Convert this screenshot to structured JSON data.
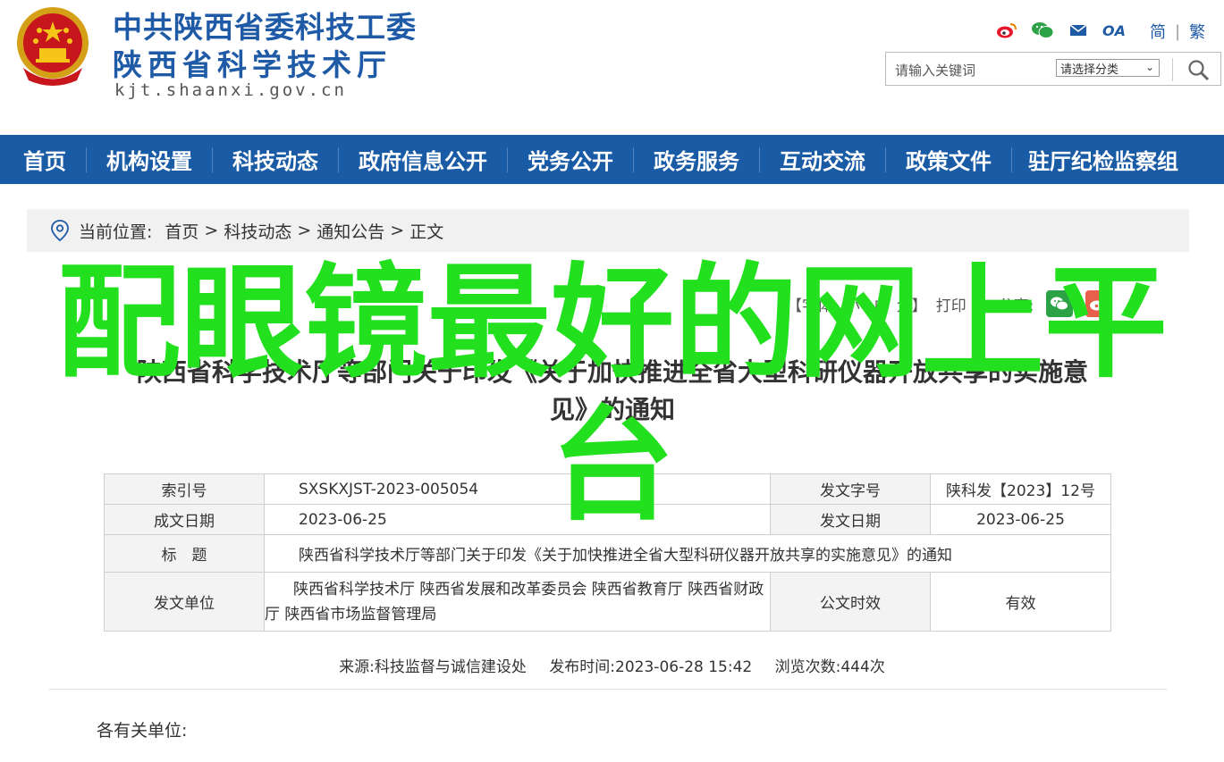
{
  "header": {
    "org_title_1": "中共陕西省委科技工委",
    "org_title_2": "陕西省科学技术厅",
    "domain": "kjt.shaanxi.gov.cn",
    "icons": [
      "weibo-icon",
      "wechat-icon",
      "mail-icon",
      "oa-icon"
    ],
    "oa_label": "OA",
    "lang_simplified": "简",
    "lang_separator": "|",
    "lang_traditional": "繁",
    "search": {
      "placeholder": "请输入关键词",
      "category_select": "请选择分类",
      "button_icon": "search-icon"
    }
  },
  "nav": {
    "items": [
      "首页",
      "机构设置",
      "科技动态",
      "政府信息公开",
      "党务公开",
      "政务服务",
      "互动交流",
      "政策文件",
      "驻厅纪检监察组"
    ]
  },
  "breadcrumb": {
    "prefix": "当前位置:",
    "items": [
      "首页",
      ">",
      "科技动态",
      ">",
      "通知公告",
      ">",
      "正文"
    ]
  },
  "tools": {
    "font_label": "【字体:",
    "font_small": "小",
    "font_medium": "中",
    "font_large": "大",
    "bracket_close": "】",
    "print": "打印",
    "share": "分享:",
    "share_icons": [
      "wechat-share-icon",
      "weibo-share-icon"
    ]
  },
  "article": {
    "title_line1": "陕西省科学技术厅等部门关于印发《关于加快推进全省大型科研仪器开放共享的实施意",
    "title_line2": "见》的通知"
  },
  "meta_table": {
    "index_label": "索引号",
    "index_value": "SXSKXJST-2023-005054",
    "doc_no_label": "发文字号",
    "doc_no_value": "陕科发【2023】12号",
    "written_label": "成文日期",
    "written_value": "2023-06-25",
    "issued_label": "发文日期",
    "issued_value": "2023-06-25",
    "subject_label": "标　题",
    "subject_value": "陕西省科学技术厅等部门关于印发《关于加快推进全省大型科研仪器开放共享的实施意见》的通知",
    "issuer_label": "发文单位",
    "issuer_value": "陕西省科学技术厅 陕西省发展和改革委员会 陕西省教育厅 陕西省财政厅 陕西省市场监督管理局",
    "validity_label": "公文时效",
    "validity_value": "有效"
  },
  "source_line": {
    "source": "来源:科技监督与诚信建设处",
    "published": "发布时间:2023-06-28 15:42",
    "views": "浏览次数:444次"
  },
  "body": {
    "greeting": "各有关单位:"
  },
  "watermark": {
    "text": "配眼镜最好的网上平台",
    "color": "#22e01e"
  },
  "colors": {
    "brand_blue": "#1a5ba6",
    "nav_text": "#ffffff",
    "weibo_red": "#e6162d",
    "wechat_green": "#2ba245"
  }
}
